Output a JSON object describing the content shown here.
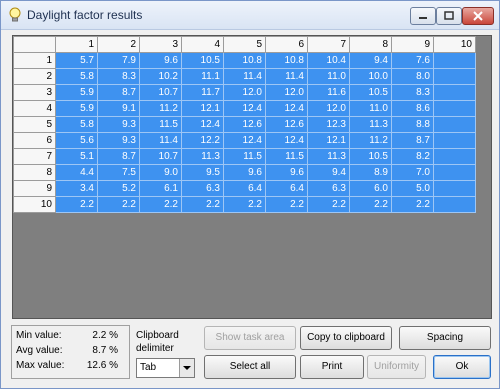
{
  "window": {
    "title": "Daylight factor results"
  },
  "grid": {
    "column_headers": [
      "1",
      "2",
      "3",
      "4",
      "5",
      "6",
      "7",
      "8",
      "9",
      "10"
    ],
    "rows": [
      {
        "label": "1",
        "cells": [
          "5.7",
          "7.9",
          "9.6",
          "10.5",
          "10.8",
          "10.8",
          "10.4",
          "9.4",
          "7.6",
          ""
        ]
      },
      {
        "label": "2",
        "cells": [
          "5.8",
          "8.3",
          "10.2",
          "11.1",
          "11.4",
          "11.4",
          "11.0",
          "10.0",
          "8.0",
          ""
        ]
      },
      {
        "label": "3",
        "cells": [
          "5.9",
          "8.7",
          "10.7",
          "11.7",
          "12.0",
          "12.0",
          "11.6",
          "10.5",
          "8.3",
          ""
        ]
      },
      {
        "label": "4",
        "cells": [
          "5.9",
          "9.1",
          "11.2",
          "12.1",
          "12.4",
          "12.4",
          "12.0",
          "11.0",
          "8.6",
          ""
        ]
      },
      {
        "label": "5",
        "cells": [
          "5.8",
          "9.3",
          "11.5",
          "12.4",
          "12.6",
          "12.6",
          "12.3",
          "11.3",
          "8.8",
          ""
        ]
      },
      {
        "label": "6",
        "cells": [
          "5.6",
          "9.3",
          "11.4",
          "12.2",
          "12.4",
          "12.4",
          "12.1",
          "11.2",
          "8.7",
          ""
        ]
      },
      {
        "label": "7",
        "cells": [
          "5.1",
          "8.7",
          "10.7",
          "11.3",
          "11.5",
          "11.5",
          "11.3",
          "10.5",
          "8.2",
          ""
        ]
      },
      {
        "label": "8",
        "cells": [
          "4.4",
          "7.5",
          "9.0",
          "9.5",
          "9.6",
          "9.6",
          "9.4",
          "8.9",
          "7.0",
          ""
        ]
      },
      {
        "label": "9",
        "cells": [
          "3.4",
          "5.2",
          "6.1",
          "6.3",
          "6.4",
          "6.4",
          "6.3",
          "6.0",
          "5.0",
          ""
        ]
      },
      {
        "label": "10",
        "cells": [
          "2.2",
          "2.2",
          "2.2",
          "2.2",
          "2.2",
          "2.2",
          "2.2",
          "2.2",
          "2.2",
          ""
        ]
      }
    ]
  },
  "stats": {
    "min_label": "Min value:",
    "min_value": "2.2 %",
    "avg_label": "Avg value:",
    "avg_value": "8.7 %",
    "max_label": "Max value:",
    "max_value": "12.6 %"
  },
  "clipboard": {
    "label": "Clipboard delimiter",
    "delimiter": "Tab"
  },
  "buttons": {
    "show_task_area": "Show task area",
    "copy_to_clipboard": "Copy to clipboard",
    "spacing": "Spacing",
    "select_all": "Select all",
    "print": "Print",
    "uniformity": "Uniformity",
    "ok": "Ok"
  },
  "colors": {
    "cell_selected": "#3e92f0",
    "grid_background": "#7f7f7f"
  }
}
